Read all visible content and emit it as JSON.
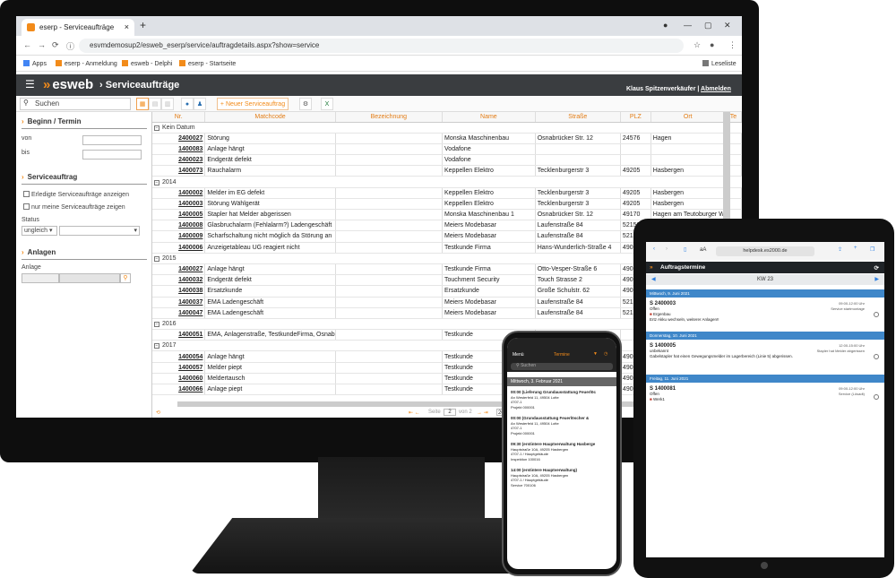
{
  "browser": {
    "tab_title": "eserp - Serviceaufträge",
    "tab_close": "×",
    "new_tab": "+",
    "url": "esvmdemosup2/esweb_eserp/service/auftragdetails.aspx?show=service",
    "bookmarks": [
      "Apps",
      "eserp - Anmeldung",
      "esweb - Delphi",
      "eserp - Startseite"
    ],
    "reading_list": "Leseliste"
  },
  "app": {
    "logo": "esweb",
    "title": "Serviceaufträge",
    "user": "Klaus Spitzenverkäufer",
    "logout": "Abmelden",
    "search_placeholder": "Suchen",
    "new_button": "+ Neuer Serviceauftrag"
  },
  "sidebar": {
    "section1": "Beginn / Termin",
    "von": "von",
    "bis": "bis",
    "section2": "Serviceauftrag",
    "chk1": "Erledigte Serviceaufträge anzeigen",
    "chk2": "nur meine Serviceaufträge zeigen",
    "status_label": "Status",
    "status_value": "ungleich",
    "section3": "Anlagen",
    "anlage_label": "Anlage"
  },
  "grid": {
    "columns": [
      "Nr.",
      "Matchcode",
      "Bezeichnung",
      "Name",
      "Straße",
      "PLZ",
      "Ort",
      "Te"
    ],
    "groups": [
      {
        "label": "Kein Datum",
        "rows": [
          [
            "2400027",
            "Störung",
            "",
            "Monska Maschinenbau",
            "Osnabrücker Str. 12",
            "24576",
            "Hagen"
          ],
          [
            "1400083",
            "Anlage hängt",
            "",
            "Vodafone",
            "",
            "",
            ""
          ],
          [
            "2400023",
            "Endgerät defekt",
            "",
            "Vodafone",
            "",
            "",
            ""
          ],
          [
            "1400073",
            "Rauchalarm",
            "",
            "Keppellen Elektro",
            "Tecklenburgerstr 3",
            "49205",
            "Hasbergen"
          ]
        ]
      },
      {
        "label": "2014",
        "rows": [
          [
            "1400002",
            "Melder im EG defekt",
            "",
            "Keppellen Elektro",
            "Tecklenburgerstr 3",
            "49205",
            "Hasbergen"
          ],
          [
            "1400003",
            "Störung Wählgerät",
            "",
            "Keppellen Elektro",
            "Tecklenburgerstr 3",
            "49205",
            "Hasbergen"
          ],
          [
            "1400005",
            "Stapler hat Melder abgerissen",
            "",
            "Monska Maschinenbau 1",
            "Osnabrücker Str. 12",
            "49170",
            "Hagen am Teutoburger W"
          ],
          [
            "1400008",
            "Glasbruchalarm (Fehlalarm?) Ladengeschäft",
            "",
            "Meiers Modebasar",
            "Laufenstraße 84",
            "52156",
            "Monschau"
          ],
          [
            "1400009",
            "Scharfschaltung nicht möglich da Störung an",
            "",
            "Meiers Modebasar",
            "Laufenstraße 84",
            "52156",
            "Monschau"
          ],
          [
            "1400006",
            "Anzeigetableau UG reagiert nicht",
            "",
            "Testkunde Firma",
            "Hans-Wunderlich-Straße 4",
            "49078",
            "Osnabrück"
          ]
        ]
      },
      {
        "label": "2015",
        "rows": [
          [
            "1400027",
            "Anlage hängt",
            "",
            "Testkunde Firma",
            "Otto-Vesper-Straße 6",
            "4907",
            ""
          ],
          [
            "1400032",
            "Endgerät defekt",
            "",
            "Touchment Security",
            "Touch Strasse 2",
            "4907",
            ""
          ],
          [
            "1400038",
            "Ersatzkunde",
            "",
            "Ersatzkunde",
            "Große Schulstr. 62",
            "4907",
            ""
          ],
          [
            "1400037",
            "EMA Ladengeschäft",
            "",
            "Meiers Modebasar",
            "Laufenstraße 84",
            "5215",
            ""
          ],
          [
            "1400047",
            "EMA Ladengeschäft",
            "",
            "Meiers Modebasar",
            "Laufenstraße 84",
            "5215",
            ""
          ]
        ]
      },
      {
        "label": "2016",
        "rows": [
          [
            "1400051",
            "EMA, Anlagenstraße, TestkundeFirma, Osnab",
            "",
            "Testkunde",
            "",
            "",
            ""
          ]
        ]
      },
      {
        "label": "2017",
        "rows": [
          [
            "1400054",
            "Anlage hängt",
            "",
            "Testkunde",
            "",
            "4907",
            ""
          ],
          [
            "1400057",
            "Melder piept",
            "",
            "Testkunde",
            "",
            "4907",
            ""
          ],
          [
            "1400060",
            "Meldertausch",
            "",
            "Testkunde",
            "",
            "4907",
            ""
          ],
          [
            "1400066",
            "Anlage piept",
            "",
            "Testkunde",
            "",
            "4907",
            ""
          ]
        ]
      }
    ],
    "pager": {
      "page_label": "Seite",
      "page": "2",
      "of": "von 2",
      "size": "20"
    }
  },
  "phone": {
    "menu": "Menü",
    "title": "Termine",
    "search": "Suchen",
    "date": "Mittwoch, 3. Februar 2021",
    "items": [
      {
        "head": "00:00 (Lieferung Grundausstattung Feuerlöc",
        "l1": "An Westerfeld 11, 49504 Lotte",
        "l2": "4707-1",
        "l3": "Projekt 000001"
      },
      {
        "head": "00:00 (Grundausstattung Feuerlöscher &",
        "l1": "An Westerfeld 11, 49504 Lotte",
        "l2": "4707-1",
        "l3": "Projekt 000001"
      },
      {
        "head": "09:30 (erstintere Hauptverwaltung Hasberge",
        "l1": "Hauptstraße 10A, 49205 Hasbergen",
        "l2": "4707-1 / Hauptgebäude",
        "l3": "Inspektion 100016"
      },
      {
        "head": "14:00 (erstintere Hauptverwaltung)",
        "l1": "Hauptstraße 10A, 49205 Hasbergen",
        "l2": "4707-1 / Hauptgebäude",
        "l3": "Service 700106"
      }
    ]
  },
  "tablet": {
    "url": "helpdesk.es2000.de",
    "aa": "aA",
    "title": "Auftragstermine",
    "week": "KW 23",
    "days": [
      {
        "label": "Mittwoch, 9. Juni 2021",
        "no": "S 2400003",
        "type": "Offen",
        "desc": "Ergenbau",
        "note": "Ertz Akku wechseln, weiterer Anlagen!!",
        "time": "09:00-12:00 Uhr",
        "tech": "Service startmontage"
      },
      {
        "label": "Donnerstag, 10. Juni 2021",
        "no": "S 1400005",
        "type": "unbekannt",
        "desc": "Stapler hat Melder abgerissen",
        "note": "Gabelstapler hat einen Gewegungsmelder im Lagerbereich (Linie 5) abgerissen.",
        "time": "12:00-15:00 Uhr",
        "tech": "Stapler hat Melder abgerissen"
      },
      {
        "label": "Freitag, 11. Juni 2021",
        "no": "S 1400081",
        "type": "Offen",
        "desc": "Werk1",
        "note": "",
        "time": "09:00-12:00 Uhr",
        "tech": "Service (Lösadt)"
      }
    ]
  }
}
